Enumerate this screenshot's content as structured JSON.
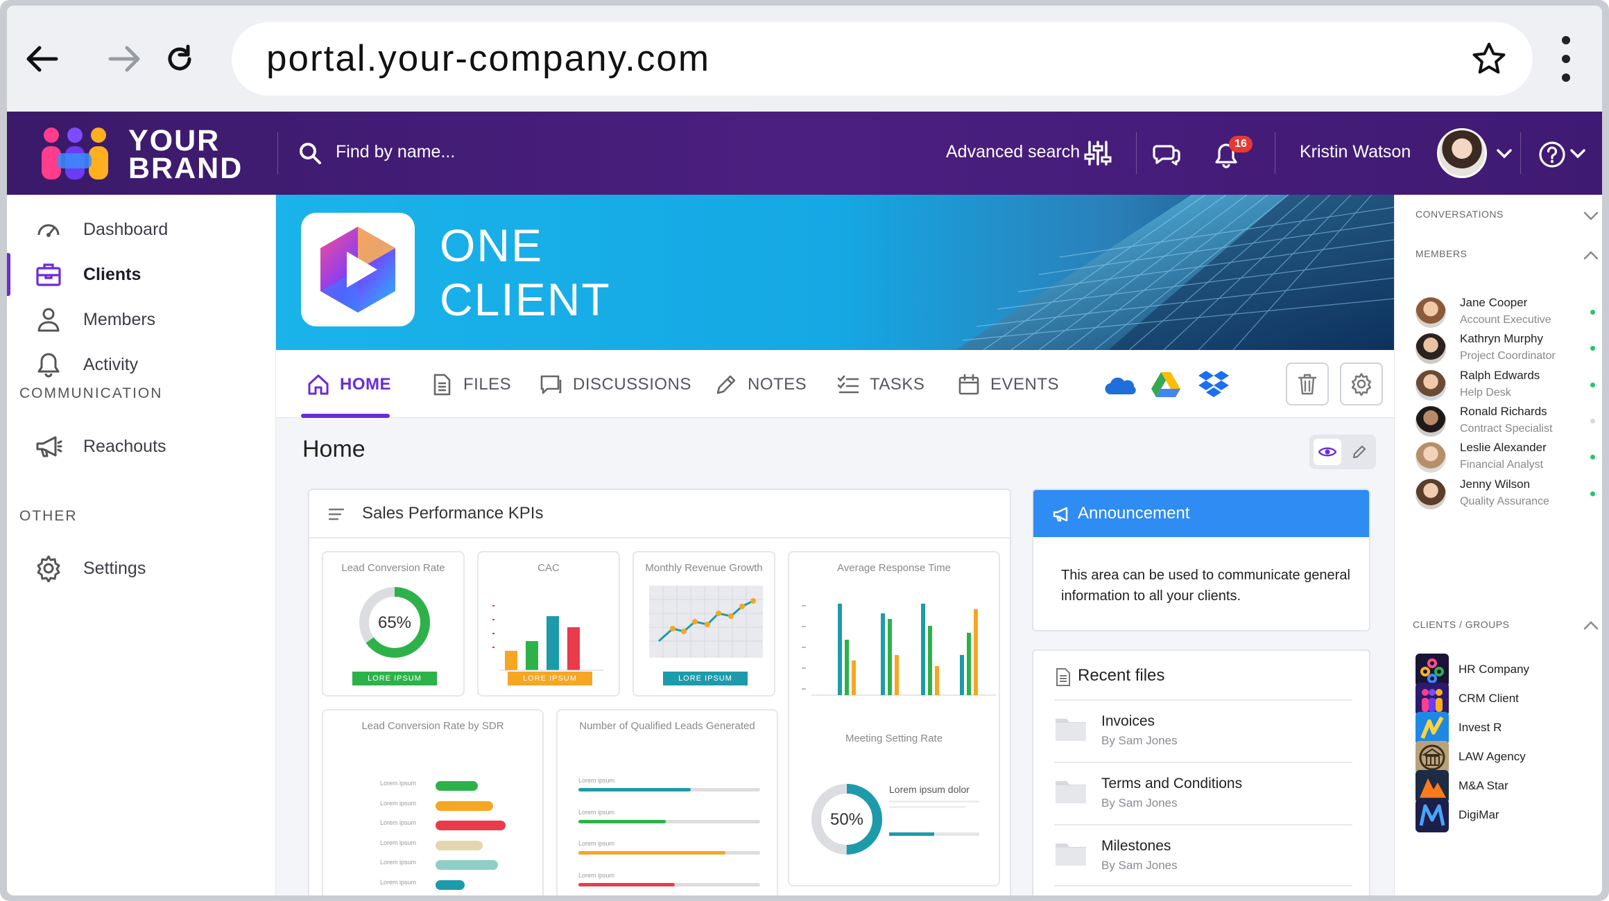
{
  "browser": {
    "url": "portal.your-company.com"
  },
  "header": {
    "brand_line1": "YOUR",
    "brand_line2": "BRAND",
    "search_placeholder": "Find by name...",
    "advanced_search": "Advanced search",
    "notification_count": "16",
    "user_name": "Kristin Watson"
  },
  "sidebar": {
    "items": [
      {
        "label": "Dashboard",
        "icon": "gauge-icon"
      },
      {
        "label": "Clients",
        "icon": "briefcase-icon"
      },
      {
        "label": "Members",
        "icon": "person-icon"
      },
      {
        "label": "Activity",
        "icon": "bell-icon"
      }
    ],
    "section_communication": "COMMUNICATION",
    "reachouts": "Reachouts",
    "section_other": "OTHER",
    "settings": "Settings"
  },
  "banner": {
    "line1": "ONE",
    "line2": "CLIENT"
  },
  "tabs": [
    "HOME",
    "FILES",
    "DISCUSSIONS",
    "NOTES",
    "TASKS",
    "EVENTS"
  ],
  "page": {
    "title": "Home"
  },
  "kpi": {
    "title": "Sales Performance KPIs",
    "cards": {
      "lead_conversion": {
        "title": "Lead Conversion Rate",
        "value": "65%",
        "percent": 65,
        "tag": "LORE IPSUM"
      },
      "cac": {
        "title": "CAC",
        "tag": "LORE IPSUM"
      },
      "revenue_growth": {
        "title": "Monthly Revenue Growth",
        "tag": "LORE IPSUM"
      },
      "response_time": {
        "title": "Average Response Time"
      },
      "by_sdr": {
        "title": "Lead Conversion Rate by SDR",
        "row_label": "Lorem ipsum"
      },
      "qualified_leads": {
        "title": "Number of Qualified Leads Generated",
        "row_label": "Lorem ipsum"
      },
      "meeting_rate": {
        "title": "Meeting Setting Rate",
        "value": "50%",
        "percent": 50,
        "caption": "Lorem ipsum dolor"
      }
    }
  },
  "announcement": {
    "title": "Announcement",
    "body": "This area can be used to communicate general information to all your clients."
  },
  "recent_files": {
    "title": "Recent files",
    "items": [
      {
        "name": "Invoices",
        "by": "By Sam Jones"
      },
      {
        "name": "Terms and Conditions",
        "by": "By Sam Jones"
      },
      {
        "name": "Milestones",
        "by": "By Sam Jones"
      }
    ]
  },
  "right_panel": {
    "conversations": "CONVERSATIONS",
    "members_label": "MEMBERS",
    "members": [
      {
        "name": "Jane Cooper",
        "role": "Account Executive",
        "online": true
      },
      {
        "name": "Kathryn Murphy",
        "role": "Project Coordinator",
        "online": true
      },
      {
        "name": "Ralph Edwards",
        "role": "Help Desk",
        "online": true
      },
      {
        "name": "Ronald Richards",
        "role": "Contract Specialist",
        "online": false
      },
      {
        "name": "Leslie Alexander",
        "role": "Financial Analyst",
        "online": true
      },
      {
        "name": "Jenny Wilson",
        "role": "Quality Assurance",
        "online": true
      }
    ],
    "clients_label": "CLIENTS / GROUPS",
    "clients": [
      "HR Company",
      "CRM Client",
      "Invest R",
      "LAW Agency",
      "M&A Star",
      "DigiMar"
    ]
  },
  "colors": {
    "accent": "#6b2bd9",
    "header_bg": "#3f1a72",
    "announcement": "#2f8cf3",
    "online": "#27c46b"
  }
}
